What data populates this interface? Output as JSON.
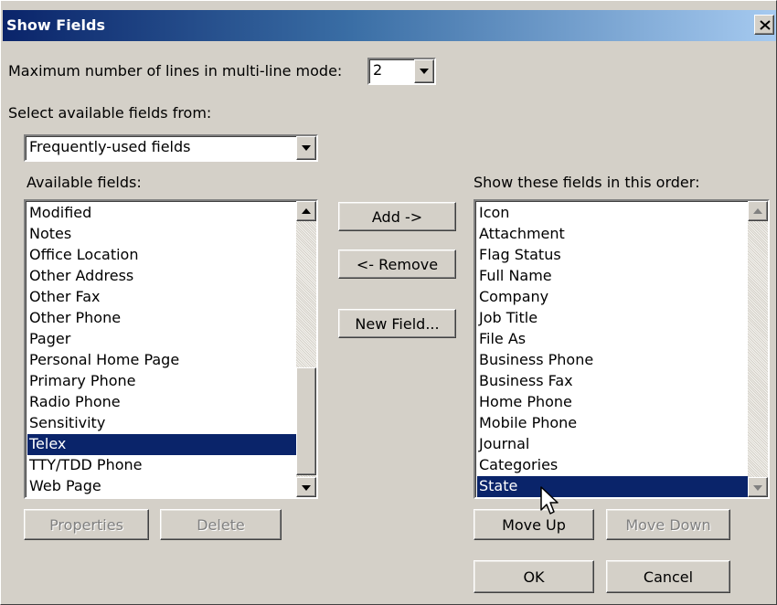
{
  "dialog": {
    "title": "Show Fields",
    "close_label": "close"
  },
  "max_lines": {
    "label": "Maximum number of lines in multi-line mode:",
    "value": "2"
  },
  "source": {
    "label": "Select available fields from:",
    "value": "Frequently-used fields"
  },
  "available": {
    "label": "Available fields:",
    "items": [
      "Modified",
      "Notes",
      "Office Location",
      "Other Address",
      "Other Fax",
      "Other Phone",
      "Pager",
      "Personal Home Page",
      "Primary Phone",
      "Radio Phone",
      "Sensitivity",
      "Telex",
      "TTY/TDD Phone",
      "Web Page"
    ],
    "selected_index": 11
  },
  "shown": {
    "label": "Show these fields in this order:",
    "items": [
      "Icon",
      "Attachment",
      "Flag Status",
      "Full Name",
      "Company",
      "Job Title",
      "File As",
      "Business Phone",
      "Business Fax",
      "Home Phone",
      "Mobile Phone",
      "Journal",
      "Categories",
      "State"
    ],
    "selected_index": 13
  },
  "buttons": {
    "add": "Add ->",
    "remove": "<- Remove",
    "new_field": "New Field...",
    "properties": "Properties",
    "delete": "Delete",
    "move_up": "Move Up",
    "move_down": "Move Down",
    "ok": "OK",
    "cancel": "Cancel"
  },
  "icons": {
    "close": "close-icon",
    "cursor": "mouse-pointer-icon"
  },
  "colors": {
    "selection": "#0a246a",
    "face": "#d4d0c8",
    "title_start": "#0a246a",
    "title_end": "#a6caf0"
  }
}
